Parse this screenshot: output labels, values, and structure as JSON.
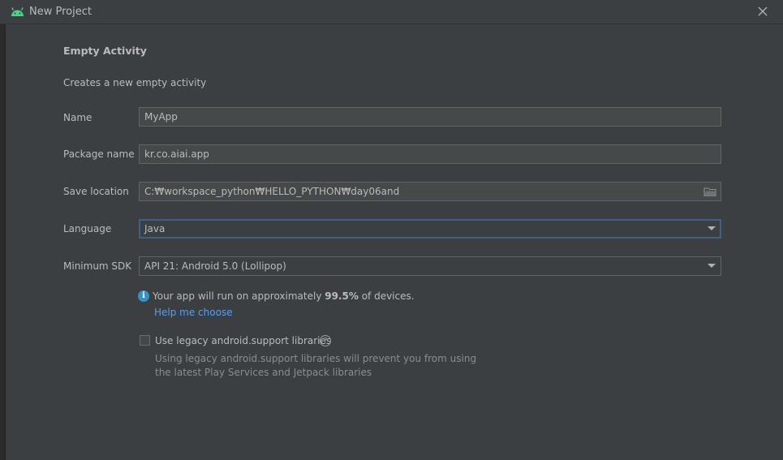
{
  "window": {
    "title": "New Project"
  },
  "form": {
    "heading": "Empty Activity",
    "description": "Creates a new empty activity",
    "name": {
      "label": "Name",
      "value": "MyApp"
    },
    "package_name": {
      "label": "Package name",
      "value": "kr.co.aiai.app"
    },
    "save_location": {
      "label": "Save location",
      "value": "C:₩workspace_python₩HELLO_PYTHON₩day06and"
    },
    "language": {
      "label": "Language",
      "value": "Java"
    },
    "minimum_sdk": {
      "label": "Minimum SDK",
      "value": "API 21: Android 5.0 (Lollipop)"
    },
    "info": {
      "prefix": "Your app will run on approximately ",
      "percent": "99.5%",
      "suffix": " of devices.",
      "link": "Help me choose"
    },
    "legacy": {
      "label": "Use legacy android.support libraries",
      "checked": false,
      "hint_line1": "Using legacy android.support libraries will prevent you from using",
      "hint_line2": "the latest Play Services and Jetpack libraries"
    }
  },
  "colors": {
    "background": "#3c3f41",
    "field_bg": "#45494a",
    "focus_border": "#3d6185",
    "link": "#589df6",
    "info_icon": "#3592c4",
    "android_green": "#3ddc84"
  },
  "icons": {
    "app": "android-icon",
    "close": "close-icon",
    "folder": "folder-icon",
    "info": "info-icon",
    "help": "question-icon",
    "dropdown": "chevron-down-icon"
  }
}
